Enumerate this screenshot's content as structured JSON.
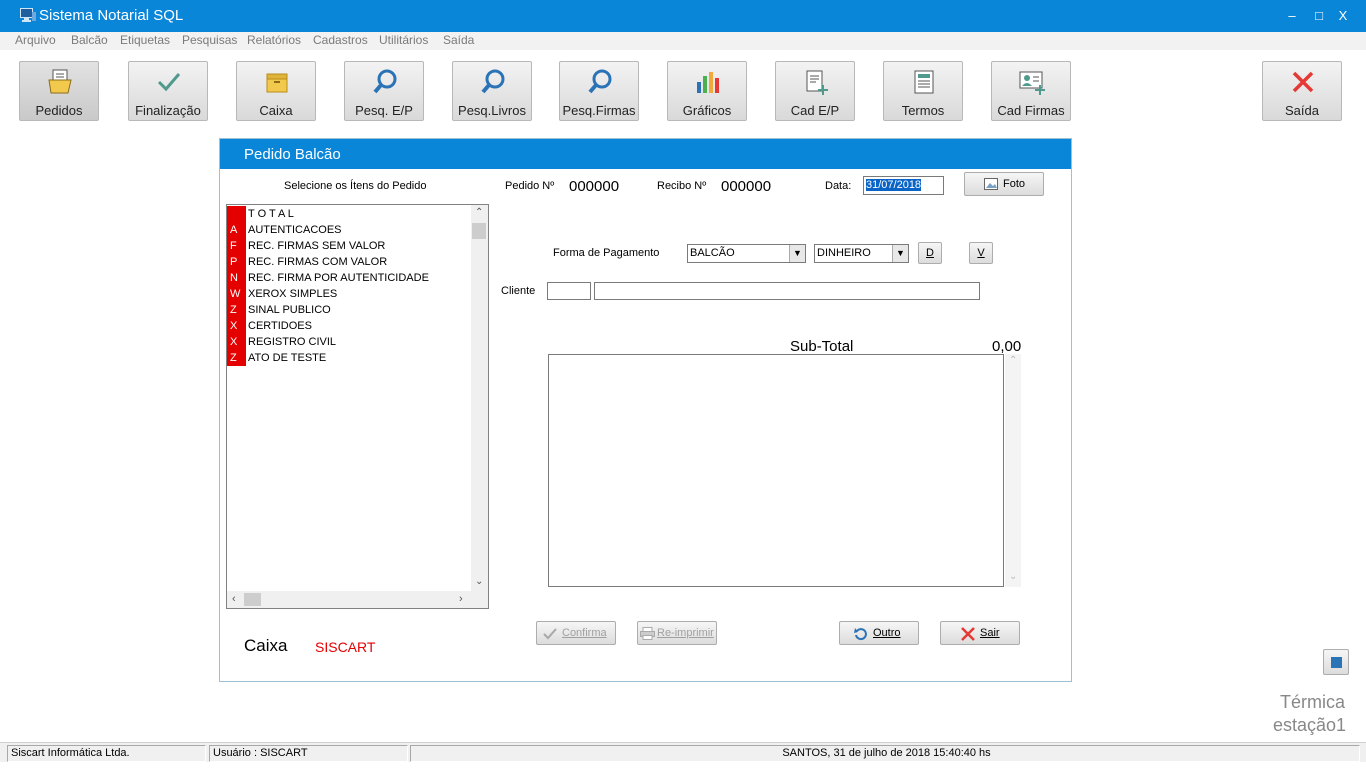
{
  "window": {
    "title": "Sistema Notarial SQL",
    "controls": {
      "minimize": "–",
      "maximize": "□",
      "close": "X"
    }
  },
  "menu": [
    "Arquivo",
    "Balcão",
    "Etiquetas",
    "Pesquisas",
    "Relatórios",
    "Cadastros",
    "Utilitários",
    "Saída"
  ],
  "toolbar": {
    "pedidos": "Pedidos",
    "finalizacao": "Finalização",
    "caixa": "Caixa",
    "pesq_ep": "Pesq. E/P",
    "pesq_livros": "Pesq.Livros",
    "pesq_firmas": "Pesq.Firmas",
    "graficos": "Gráficos",
    "cad_ep": "Cad E/P",
    "termos": "Termos",
    "cad_firmas": "Cad Firmas",
    "saida": "Saída"
  },
  "dialog": {
    "title": "Pedido Balcão",
    "items_caption": "Selecione os Ítens do Pedido",
    "items": [
      {
        "code": "",
        "label": "T O T A L"
      },
      {
        "code": "A",
        "label": "AUTENTICACOES"
      },
      {
        "code": "F",
        "label": "REC. FIRMAS SEM VALOR"
      },
      {
        "code": "P",
        "label": "REC. FIRMAS COM VALOR"
      },
      {
        "code": "N",
        "label": "REC. FIRMA POR AUTENTICIDADE"
      },
      {
        "code": "W",
        "label": "XEROX SIMPLES"
      },
      {
        "code": "Z",
        "label": "SINAL PUBLICO"
      },
      {
        "code": "X",
        "label": "CERTIDOES"
      },
      {
        "code": "X",
        "label": "REGISTRO CIVIL"
      },
      {
        "code": "Z",
        "label": "ATO DE TESTE"
      }
    ],
    "pedido_label": "Pedido Nº",
    "pedido_value": "000000",
    "recibo_label": "Recibo Nº",
    "recibo_value": "000000",
    "data_label": "Data:",
    "data_value": "31/07/2018",
    "foto_button": "Foto",
    "pagamento_label": "Forma de Pagamento",
    "pagamento_local": "BALCÃO",
    "pagamento_tipo": "DINHEIRO",
    "btn_d": "D",
    "btn_v": "V",
    "cliente_label": "Cliente",
    "cliente_code": "",
    "cliente_name": "",
    "subtotal_label": "Sub-Total",
    "subtotal_value": "0,00",
    "confirma_button": "Confirma",
    "reimprimir_button": "Re-imprimir",
    "outro_button": "Outro",
    "sair_button": "Sair",
    "caixa_label": "Caixa",
    "caixa_user": "SISCART"
  },
  "printer": {
    "line1": "Térmica",
    "line2": "estação1"
  },
  "status": {
    "company": "Siscart Informática Ltda.",
    "user": "Usuário : SISCART",
    "datetime": "SANTOS, 31 de julho de 2018  15:40:40 hs"
  },
  "colors": {
    "accent": "#0a86d9",
    "code_red": "#e50000",
    "danger": "#e53935",
    "icon_blue": "#2a73b6"
  }
}
